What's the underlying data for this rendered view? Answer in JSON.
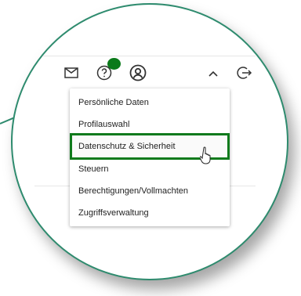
{
  "header": {
    "icons": [
      "mail-icon",
      "help-icon",
      "user-icon",
      "chevron-up-icon",
      "logout-icon"
    ],
    "badge_color": "#0a7a1a"
  },
  "menu": {
    "items": [
      {
        "label": "Persönliche Daten"
      },
      {
        "label": "Profilauswahl"
      },
      {
        "label": "Datenschutz & Sicherheit"
      },
      {
        "label": "Steuern"
      },
      {
        "label": "Berechtigungen/Vollmachten"
      },
      {
        "label": "Zugriffsverwaltung"
      }
    ],
    "active_index": 2,
    "highlight_color": "#0f7a1c"
  },
  "magnifier_border_color": "#2e8b6e"
}
